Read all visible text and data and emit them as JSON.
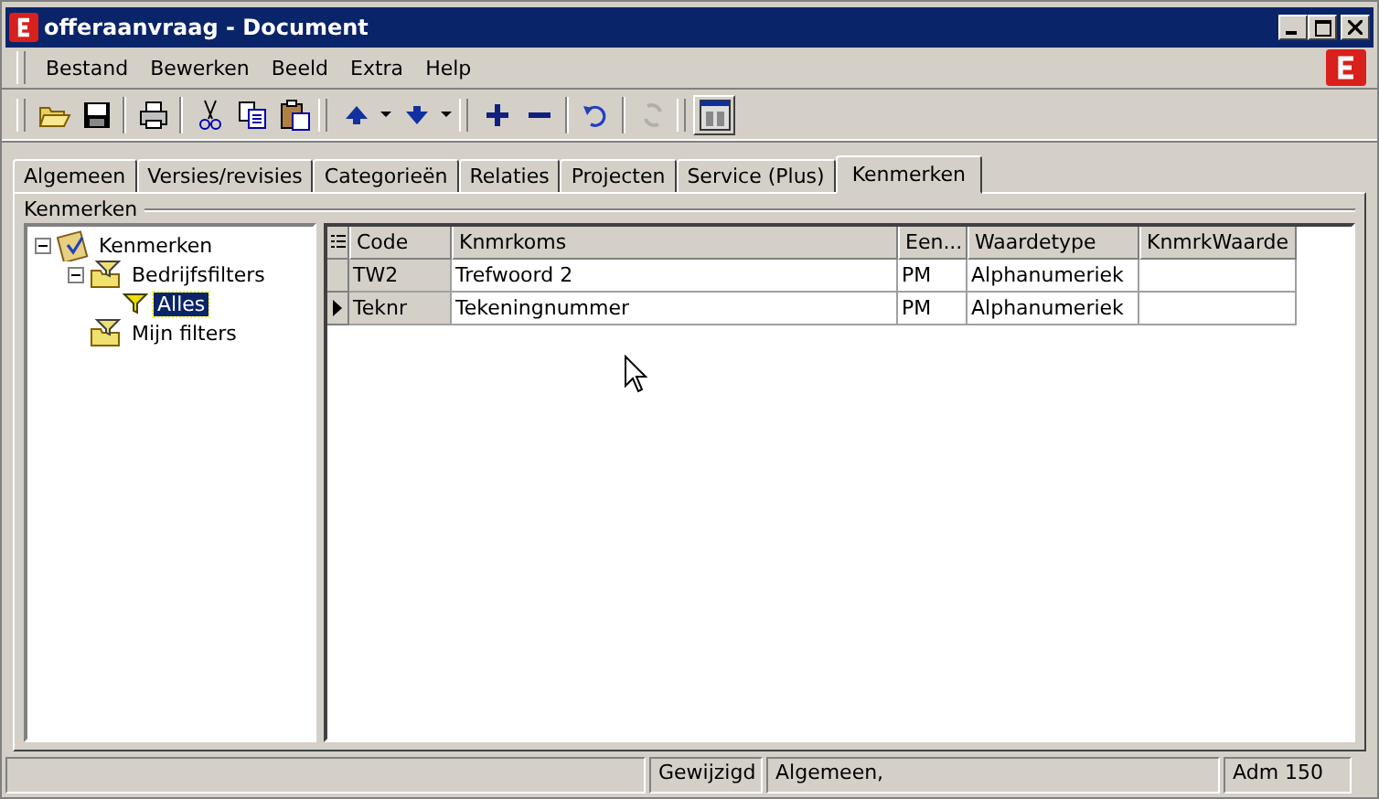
{
  "window": {
    "title": "offeraanvraag - Document"
  },
  "menu": [
    "Bestand",
    "Bewerken",
    "Beeld",
    "Extra",
    "Help"
  ],
  "toolbar": [
    [
      {
        "kind": "open",
        "disabled": false
      },
      {
        "kind": "save",
        "disabled": false
      }
    ],
    [
      {
        "kind": "print",
        "disabled": false
      }
    ],
    [
      {
        "kind": "cut",
        "disabled": false
      },
      {
        "kind": "copy",
        "disabled": false
      },
      {
        "kind": "paste",
        "disabled": false
      }
    ],
    [
      {
        "kind": "up",
        "disabled": false
      },
      {
        "kind": "dropdown",
        "disabled": false
      },
      {
        "kind": "down",
        "disabled": false
      },
      {
        "kind": "dropdown",
        "disabled": false
      }
    ],
    [
      {
        "kind": "plus",
        "disabled": false
      },
      {
        "kind": "minus",
        "disabled": false
      }
    ],
    [
      {
        "kind": "undo",
        "disabled": false
      }
    ],
    [
      {
        "kind": "refresh",
        "disabled": true
      }
    ],
    [
      {
        "kind": "layout",
        "disabled": false
      }
    ]
  ],
  "tabs": [
    {
      "label": "Algemeen",
      "selected": false
    },
    {
      "label": "Versies/revisies",
      "selected": false
    },
    {
      "label": "Categorieën",
      "selected": false
    },
    {
      "label": "Relaties",
      "selected": false
    },
    {
      "label": "Projecten",
      "selected": false
    },
    {
      "label": "Service (Plus)",
      "selected": false
    },
    {
      "label": "Kenmerken",
      "selected": true
    }
  ],
  "group": {
    "title": "Kenmerken"
  },
  "tree": [
    {
      "label": "Kenmerken",
      "kind": "root",
      "expanded": true,
      "selected": false,
      "children": [
        {
          "label": "Bedrijfsfilters",
          "kind": "folder",
          "expanded": true,
          "selected": false,
          "children": [
            {
              "label": "Alles",
              "kind": "filter",
              "selected": true
            }
          ]
        },
        {
          "label": "Mijn filters",
          "kind": "folder",
          "selected": false
        }
      ]
    }
  ],
  "table": {
    "columns": [
      "Code",
      "Knmrkoms",
      "Een...",
      "Waardetype",
      "KnmrkWaarde"
    ],
    "rows": [
      {
        "current": false,
        "cells": [
          "TW2",
          "Trefwoord 2",
          "PM",
          "Alphanumeriek",
          ""
        ]
      },
      {
        "current": true,
        "cells": [
          "Teknr",
          "Tekeningnummer",
          "PM",
          "Alphanumeriek",
          ""
        ]
      }
    ]
  },
  "status_bar": [
    "Gewijzigd",
    "Algemeen,",
    "Adm 150"
  ]
}
